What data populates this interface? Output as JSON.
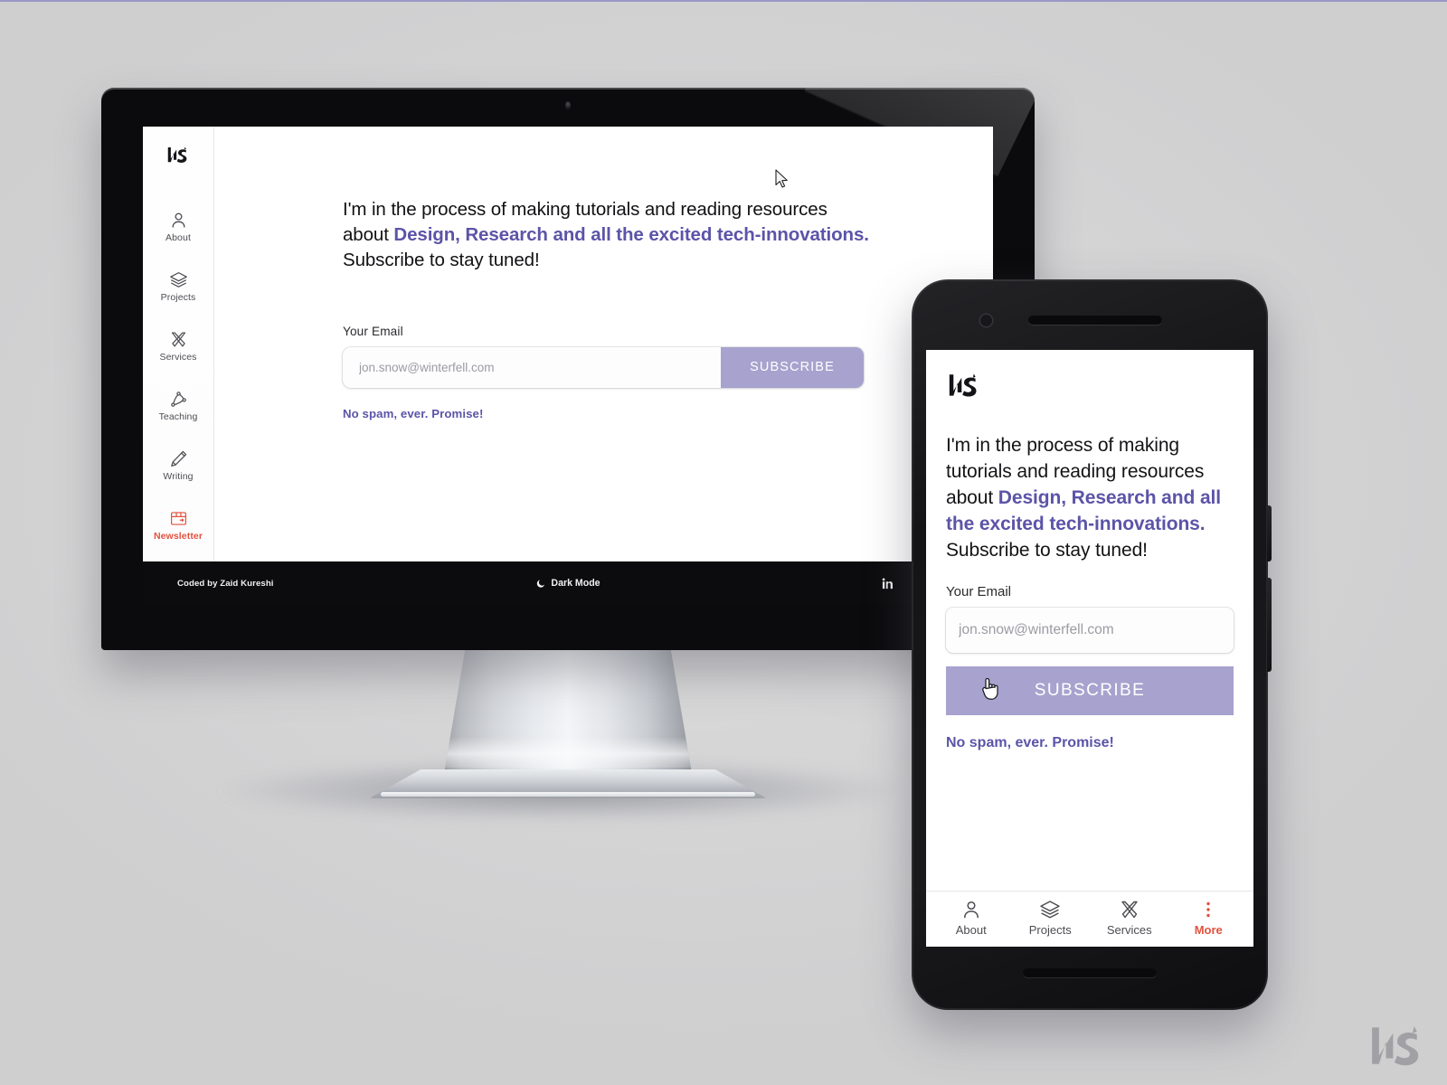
{
  "brand": {
    "logo_name": "ns-monogram-logo",
    "accent_purple": "#5b54a8",
    "accent_lavender": "#a7a2ce",
    "accent_red": "#e2523f",
    "background": "#d7d7d8"
  },
  "desktop": {
    "sidebar": {
      "items": [
        {
          "label": "About",
          "icon": "person-icon",
          "active": false
        },
        {
          "label": "Projects",
          "icon": "layers-icon",
          "active": false
        },
        {
          "label": "Services",
          "icon": "tools-icon",
          "active": false
        },
        {
          "label": "Teaching",
          "icon": "node-graph-icon",
          "active": false
        },
        {
          "label": "Writing",
          "icon": "pencil-icon",
          "active": false
        },
        {
          "label": "Newsletter",
          "icon": "package-icon",
          "active": true
        }
      ]
    },
    "main": {
      "lede_part1": "I'm in the process of making tutorials and reading resources about ",
      "lede_highlight": "Design, Research and all the excited tech-innovations.",
      "lede_part2": " Subscribe to stay tuned!",
      "field_label": "Your Email",
      "email_placeholder": "jon.snow@winterfell.com",
      "email_value": "",
      "subscribe_label": "SUBSCRIBE",
      "promise": "No spam, ever. Promise!"
    },
    "footer": {
      "credit": "Coded by Zaid Kureshi",
      "dark_mode_label": "Dark Mode",
      "dark_mode_icon": "moon-icon",
      "socials": [
        {
          "name": "linkedin-icon"
        },
        {
          "name": "twitter-icon"
        },
        {
          "name": "medium-icon"
        }
      ]
    }
  },
  "mobile": {
    "main": {
      "lede_part1": "I'm in the process of making tutorials and reading resources about ",
      "lede_highlight": "Design, Research and all the excited tech-innovations.",
      "lede_part2": " Subscribe to stay tuned!",
      "field_label": "Your Email",
      "email_placeholder": "jon.snow@winterfell.com",
      "email_value": "",
      "subscribe_label": "SUBSCRIBE",
      "promise": "No spam, ever. Promise!"
    },
    "tabbar": {
      "items": [
        {
          "label": "About",
          "icon": "person-icon",
          "active": false
        },
        {
          "label": "Projects",
          "icon": "layers-icon",
          "active": false
        },
        {
          "label": "Services",
          "icon": "tools-icon",
          "active": false
        },
        {
          "label": "More",
          "icon": "dots-vertical-icon",
          "active": true
        }
      ]
    }
  },
  "cursors": {
    "desktop_pointer": "arrow-cursor",
    "mobile_pointer": "hand-cursor"
  }
}
